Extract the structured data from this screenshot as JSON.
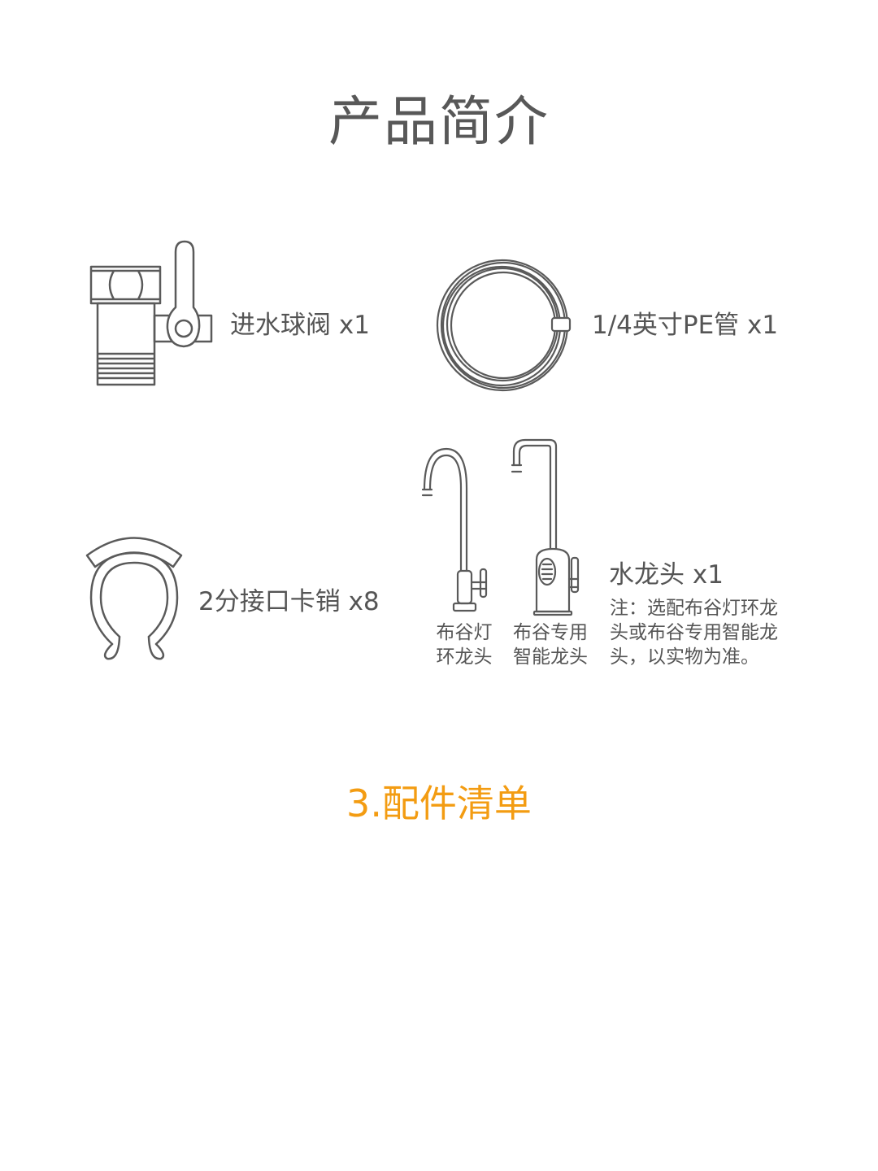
{
  "page": {
    "title": "产品简介"
  },
  "items": {
    "valve": {
      "label": "进水球阀 x1",
      "icon": "ball-valve-icon"
    },
    "tube": {
      "label": "1/4英寸PE管 x1",
      "icon": "coiled-tube-icon"
    },
    "clip": {
      "label": "2分接口卡销 x8",
      "icon": "clip-icon"
    },
    "faucet": {
      "label": "水龙头 x1",
      "note_lines": [
        "注：选配布谷灯环龙",
        "头或布谷专用智能龙",
        "头，以实物为准。"
      ],
      "options": [
        {
          "icon": "ring-light-faucet-icon",
          "caption_lines": [
            "布谷灯",
            "环龙头"
          ]
        },
        {
          "icon": "smart-faucet-icon",
          "caption_lines": [
            "布谷专用",
            "智能龙头"
          ]
        }
      ]
    }
  },
  "section": {
    "heading": "3.配件清单"
  },
  "colors": {
    "text": "#555555",
    "line": "#5a5a5a",
    "accent": "#f39c12"
  }
}
